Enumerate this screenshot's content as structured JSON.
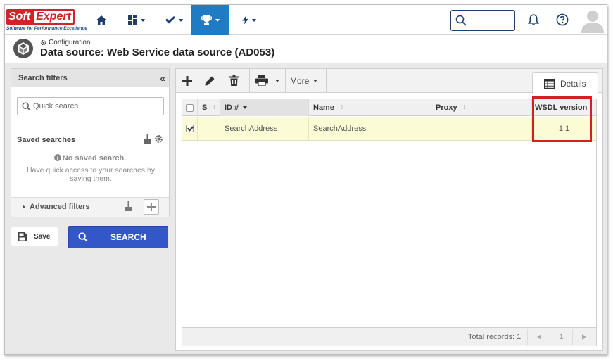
{
  "brand": {
    "logo_left": "Soft",
    "logo_right": "Expert",
    "tagline": "Software for Performance Excellence"
  },
  "topnav": {
    "icons": [
      "home-icon",
      "dashboard-icon",
      "check-icon",
      "trophy-icon",
      "bolt-icon"
    ],
    "active_index": 3,
    "active_color": "#1e7bc4"
  },
  "header": {
    "breadcrumb": "Configuration",
    "title": "Data source: Web Service data source (AD053)"
  },
  "filters": {
    "title": "Search filters",
    "collapse": "«",
    "quick_search_placeholder": "Quick search",
    "saved_title": "Saved searches",
    "no_saved": "No saved search.",
    "no_saved_desc": "Have quick access to your searches by saving them.",
    "advanced": "Advanced filters",
    "save_label": "Save",
    "search_label": "SEARCH"
  },
  "toolbar": {
    "more_label": "More",
    "details_tab": "Details"
  },
  "grid": {
    "columns": [
      "S",
      "ID #",
      "Name",
      "Proxy",
      "WSDL version"
    ],
    "rows": [
      {
        "checked": true,
        "s": "",
        "id": "SearchAddress",
        "name": "SearchAddress",
        "proxy": "",
        "wsdl": "1.1"
      }
    ],
    "total_label": "Total records: 1",
    "page": "1"
  },
  "colors": {
    "accent": "#1e7bc4",
    "search_button": "#3357c9",
    "highlight": "#d62020",
    "selected_row": "#fbfbd6"
  }
}
